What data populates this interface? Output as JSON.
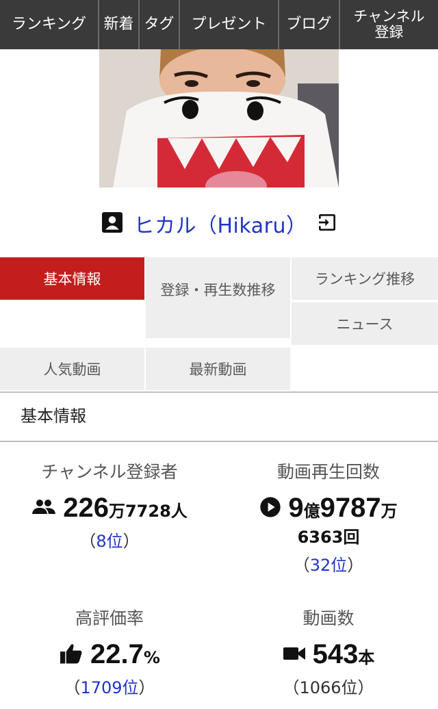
{
  "nav": {
    "items": [
      "ランキング",
      "新着",
      "タグ",
      "プレゼント",
      "ブログ",
      "チャンネル\n登録"
    ]
  },
  "channel": {
    "name": "ヒカル（Hikaru）"
  },
  "tabs": {
    "basic": "基本情報",
    "subs_trend": "登録・再生数推移",
    "ranking_trend": "ランキング推移",
    "news": "ニュース",
    "popular": "人気動画",
    "latest": "最新動画"
  },
  "section": {
    "title": "基本情報"
  },
  "stats": {
    "subscribers": {
      "label": "チャンネル登録者",
      "num1": "226",
      "unit1": "万",
      "num2": "7728",
      "unit2": "人",
      "rank_open": "（",
      "rank": "8位",
      "rank_close": "）"
    },
    "views": {
      "label": "動画再生回数",
      "num1": "9",
      "unit1": "億",
      "num2": "9787",
      "unit2": "万",
      "line2": "6363回",
      "rank_open": "（",
      "rank": "32位",
      "rank_close": "）"
    },
    "rating": {
      "label": "高評価率",
      "num": "22.7",
      "unit": "%",
      "rank_open": "（",
      "rank": "1709位",
      "rank_close": "）"
    },
    "videos": {
      "label": "動画数",
      "num": "543",
      "unit": "本",
      "rank_text": "（1066位）"
    }
  }
}
